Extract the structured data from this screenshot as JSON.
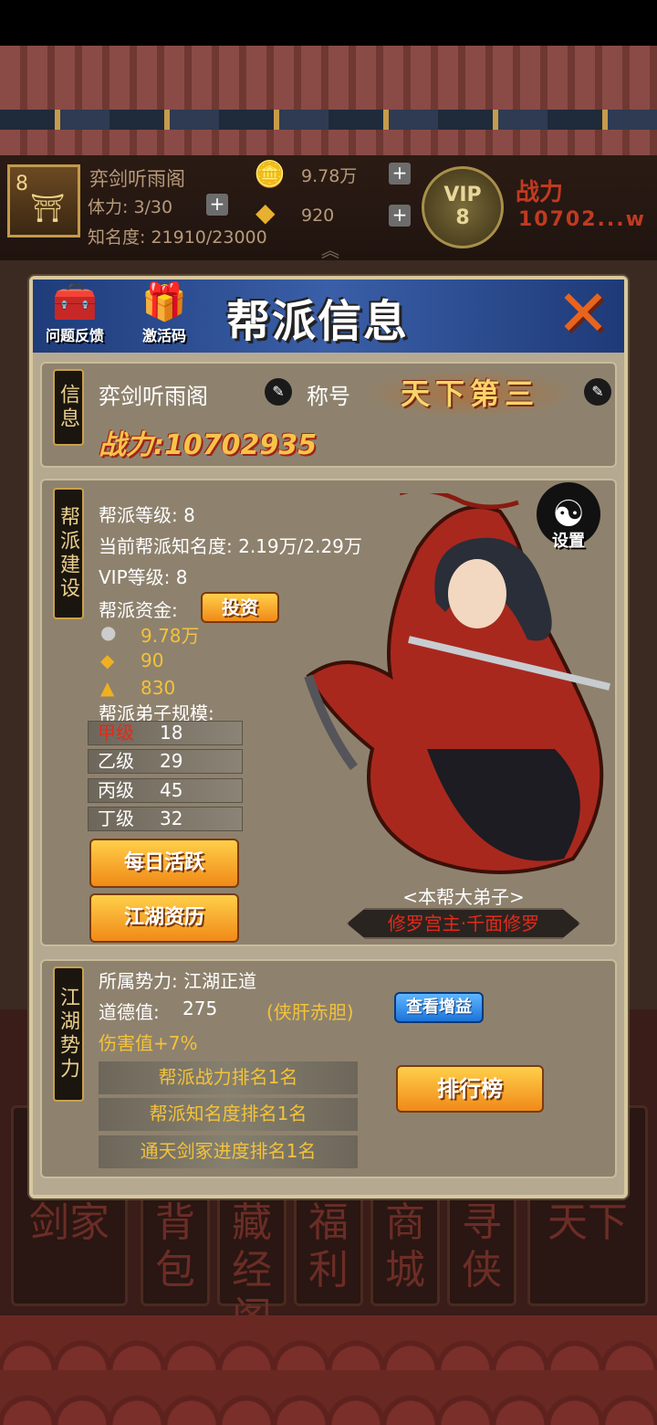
{
  "hud": {
    "level": "8",
    "gang_name": "弈剑听雨阁",
    "stamina": "体力: 3/30",
    "fame": "知名度: 21910/23000",
    "silver": "9.78万",
    "gold": "920",
    "vip": "VIP",
    "vip_level": "8",
    "power_label": "战力",
    "power_value": "10702...w"
  },
  "panel": {
    "title": "帮派信息",
    "feedback_label": "问题反馈",
    "code_label": "激活码"
  },
  "info": {
    "tag": "信息",
    "gang_name": "弈剑听雨阁",
    "title_label": "称号",
    "title_badge": "天下第三",
    "power": "战力:10702935"
  },
  "build": {
    "tag": "帮派建设",
    "level": "帮派等级:  8",
    "fame": "当前帮派知名度:  2.19万/2.29万",
    "vip": "VIP等级:  8",
    "funds_label": "帮派资金:",
    "invest_button": "投资",
    "silver": "9.78万",
    "gold": "90",
    "ingot": "830",
    "disciples_label": "帮派弟子规模:",
    "grades": [
      {
        "name": "甲级",
        "count": "18"
      },
      {
        "name": "乙级",
        "count": "29"
      },
      {
        "name": "丙级",
        "count": "45"
      },
      {
        "name": "丁级",
        "count": "32"
      }
    ],
    "daily_button": "每日活跃",
    "history_button": "江湖资历",
    "settings_label": "设置",
    "disciple_caption": "<本帮大弟子>",
    "disciple_name": "修罗宫主·千面修罗"
  },
  "faction": {
    "tag": "江湖势力",
    "affiliation": "所属势力: 江湖正道",
    "morality_label": "道德值:",
    "morality_value": "275",
    "morality_trait": "(侠肝赤胆)",
    "damage_bonus": "伤害值+7%",
    "view_button": "查看增益",
    "ranks": [
      "帮派战力排名1名",
      "帮派知名度排名1名",
      "通天剑冢进度排名1名"
    ],
    "leaderboard_button": "排行榜"
  },
  "nav": [
    "剑家",
    "背包",
    "藏经阁",
    "福利",
    "商城",
    "寻侠",
    "天下"
  ],
  "colors": {
    "panel_bg": "#b6a992",
    "title_blue": "#2a4d94",
    "accent_gold": "#f4c23a",
    "button_orange": "#f08a18",
    "red_text": "#e22a1a"
  }
}
